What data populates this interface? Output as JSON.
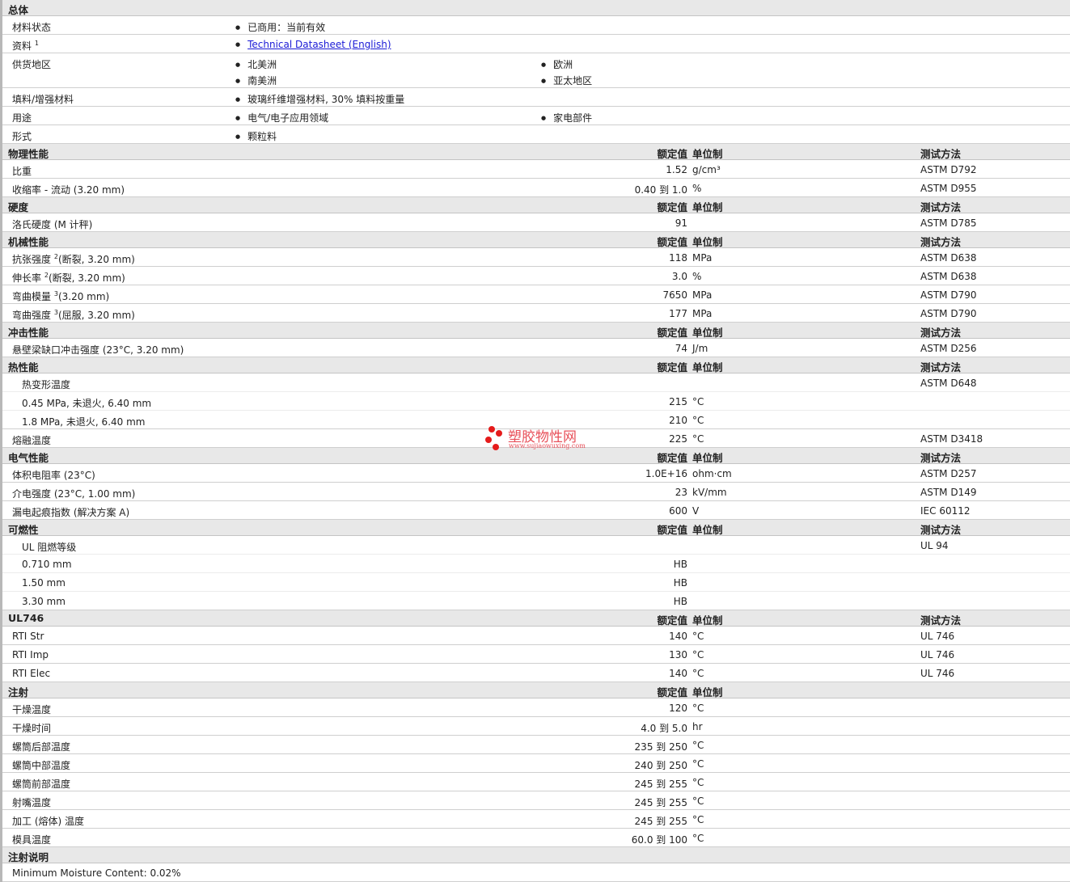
{
  "general": {
    "title": "总体",
    "rows": [
      {
        "label": "材料状态",
        "items": [
          [
            "已商用：当前有效"
          ]
        ]
      },
      {
        "label": "资料",
        "sup": "1",
        "link": "Technical Datasheet (English)"
      },
      {
        "label": "供货地区",
        "items": [
          [
            "北美洲",
            "欧洲"
          ],
          [
            "南美洲",
            "亚太地区"
          ]
        ]
      },
      {
        "label": "填料/增强材料",
        "items": [
          [
            "玻璃纤维增强材料, 30% 填料按重量"
          ]
        ]
      },
      {
        "label": "用途",
        "items": [
          [
            "电气/电子应用领域",
            "家电部件"
          ]
        ]
      },
      {
        "label": "形式",
        "items": [
          [
            "颗粒料"
          ]
        ]
      }
    ]
  },
  "headers": {
    "value": "额定值",
    "unit": "单位制",
    "method": "测试方法"
  },
  "sections": [
    {
      "title": "物理性能",
      "method_header": true,
      "rows": [
        {
          "label": "比重",
          "value": "1.52",
          "unit": "g/cm³",
          "method": "ASTM D792"
        },
        {
          "label": "收缩率 - 流动 (3.20 mm)",
          "value": "0.40 到  1.0",
          "unit": "%",
          "method": "ASTM D955"
        }
      ]
    },
    {
      "title": "硬度",
      "method_header": true,
      "rows": [
        {
          "label": "洛氏硬度 (M 计秤)",
          "value": "91",
          "unit": "",
          "method": "ASTM D785"
        }
      ]
    },
    {
      "title": "机械性能",
      "method_header": true,
      "rows": [
        {
          "label": "抗张强度",
          "sup": "2",
          "suffix": "(断裂, 3.20 mm)",
          "value": "118",
          "unit": "MPa",
          "method": "ASTM D638"
        },
        {
          "label": "伸长率",
          "sup": "2",
          "suffix": "(断裂, 3.20 mm)",
          "value": "3.0",
          "unit": "%",
          "method": "ASTM D638"
        },
        {
          "label": "弯曲模量",
          "sup": "3",
          "suffix": "(3.20 mm)",
          "value": "7650",
          "unit": "MPa",
          "method": "ASTM D790"
        },
        {
          "label": "弯曲强度",
          "sup": "3",
          "suffix": "(屈服, 3.20 mm)",
          "value": "177",
          "unit": "MPa",
          "method": "ASTM D790"
        }
      ]
    },
    {
      "title": "冲击性能",
      "method_header": true,
      "rows": [
        {
          "label": "悬壁梁缺口冲击强度 (23°C, 3.20 mm)",
          "value": "74",
          "unit": "J/m",
          "method": "ASTM D256"
        }
      ]
    },
    {
      "title": "热性能",
      "method_header": true,
      "rows": [
        {
          "label": "热变形温度",
          "value": "",
          "unit": "",
          "method": "ASTM D648",
          "parent": true
        },
        {
          "label": "0.45 MPa, 未退火, 6.40 mm",
          "value": "215",
          "unit": "°C",
          "method": "",
          "sub": true
        },
        {
          "label": "1.8 MPa, 未退火, 6.40 mm",
          "value": "210",
          "unit": "°C",
          "method": "",
          "sub": true
        },
        {
          "label": "熔融温度",
          "value": "225",
          "unit": "°C",
          "method": "ASTM D3418"
        }
      ]
    },
    {
      "title": "电气性能",
      "method_header": true,
      "rows": [
        {
          "label": "体积电阻率 (23°C)",
          "value": "1.0E+16",
          "unit": "ohm·cm",
          "method": "ASTM D257"
        },
        {
          "label": "介电强度 (23°C, 1.00 mm)",
          "value": "23",
          "unit": "kV/mm",
          "method": "ASTM D149"
        },
        {
          "label": "漏电起痕指数 (解决方案 A)",
          "value": "600",
          "unit": "V",
          "method": "IEC 60112"
        }
      ]
    },
    {
      "title": "可燃性",
      "method_header": true,
      "rows": [
        {
          "label": "UL 阻燃等级",
          "value": "",
          "unit": "",
          "method": "UL 94",
          "parent": true
        },
        {
          "label": "0.710 mm",
          "value": "HB",
          "unit": "",
          "method": "",
          "sub": true
        },
        {
          "label": "1.50 mm",
          "value": "HB",
          "unit": "",
          "method": "",
          "sub": true
        },
        {
          "label": "3.30 mm",
          "value": "HB",
          "unit": "",
          "method": "",
          "sub": true
        }
      ]
    },
    {
      "title": "UL746",
      "method_header": true,
      "rows": [
        {
          "label": "RTI Str",
          "value": "140",
          "unit": "°C",
          "method": "UL 746"
        },
        {
          "label": "RTI Imp",
          "value": "130",
          "unit": "°C",
          "method": "UL 746"
        },
        {
          "label": "RTI Elec",
          "value": "140",
          "unit": "°C",
          "method": "UL 746"
        }
      ]
    },
    {
      "title": "注射",
      "method_header": false,
      "rows": [
        {
          "label": "干燥温度",
          "value": "120",
          "unit": "°C",
          "method": ""
        },
        {
          "label": "干燥时间",
          "value": "4.0 到  5.0",
          "unit": "hr",
          "method": ""
        },
        {
          "label": "螺筒后部温度",
          "value": "235 到  250",
          "unit": "°C",
          "method": ""
        },
        {
          "label": "螺筒中部温度",
          "value": "240 到  250",
          "unit": "°C",
          "method": ""
        },
        {
          "label": "螺筒前部温度",
          "value": "245 到  255",
          "unit": "°C",
          "method": ""
        },
        {
          "label": "射嘴温度",
          "value": "245 到  255",
          "unit": "°C",
          "method": ""
        },
        {
          "label": "加工 (熔体) 温度",
          "value": "245 到  255",
          "unit": "°C",
          "method": ""
        },
        {
          "label": "模具温度",
          "value": "60.0 到  100",
          "unit": "°C",
          "method": ""
        }
      ]
    },
    {
      "title": "注射说明",
      "no_headers": true,
      "rows": [
        {
          "label": "Minimum Moisture Content: 0.02%",
          "value": "",
          "unit": "",
          "method": ""
        }
      ]
    }
  ],
  "watermark": {
    "name": "塑胶物性网",
    "url": "www.sujiaowuxing.com"
  }
}
